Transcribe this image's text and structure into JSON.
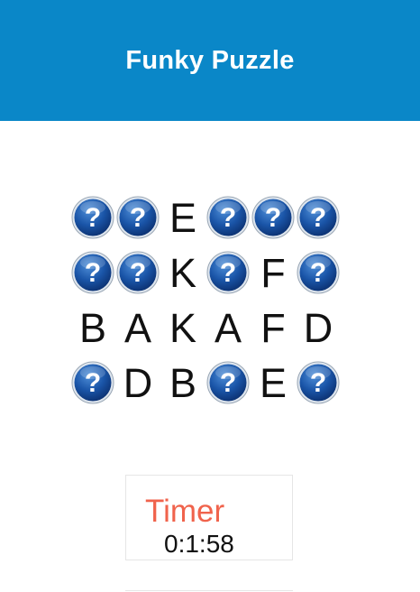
{
  "header": {
    "title": "Funky Puzzle",
    "background_color": "#0a87c8"
  },
  "board": {
    "hidden_icon": "question-mark-icon",
    "rows": [
      [
        "?",
        "?",
        "E",
        "?",
        "?",
        "?"
      ],
      [
        "?",
        "?",
        "K",
        "?",
        "F",
        "?"
      ],
      [
        "B",
        "A",
        "K",
        "A",
        "F",
        "D"
      ],
      [
        "?",
        "D",
        "B",
        "?",
        "E",
        "?"
      ]
    ]
  },
  "timer": {
    "label": "Timer",
    "value": "0:1:58",
    "label_color": "#f0634c"
  }
}
